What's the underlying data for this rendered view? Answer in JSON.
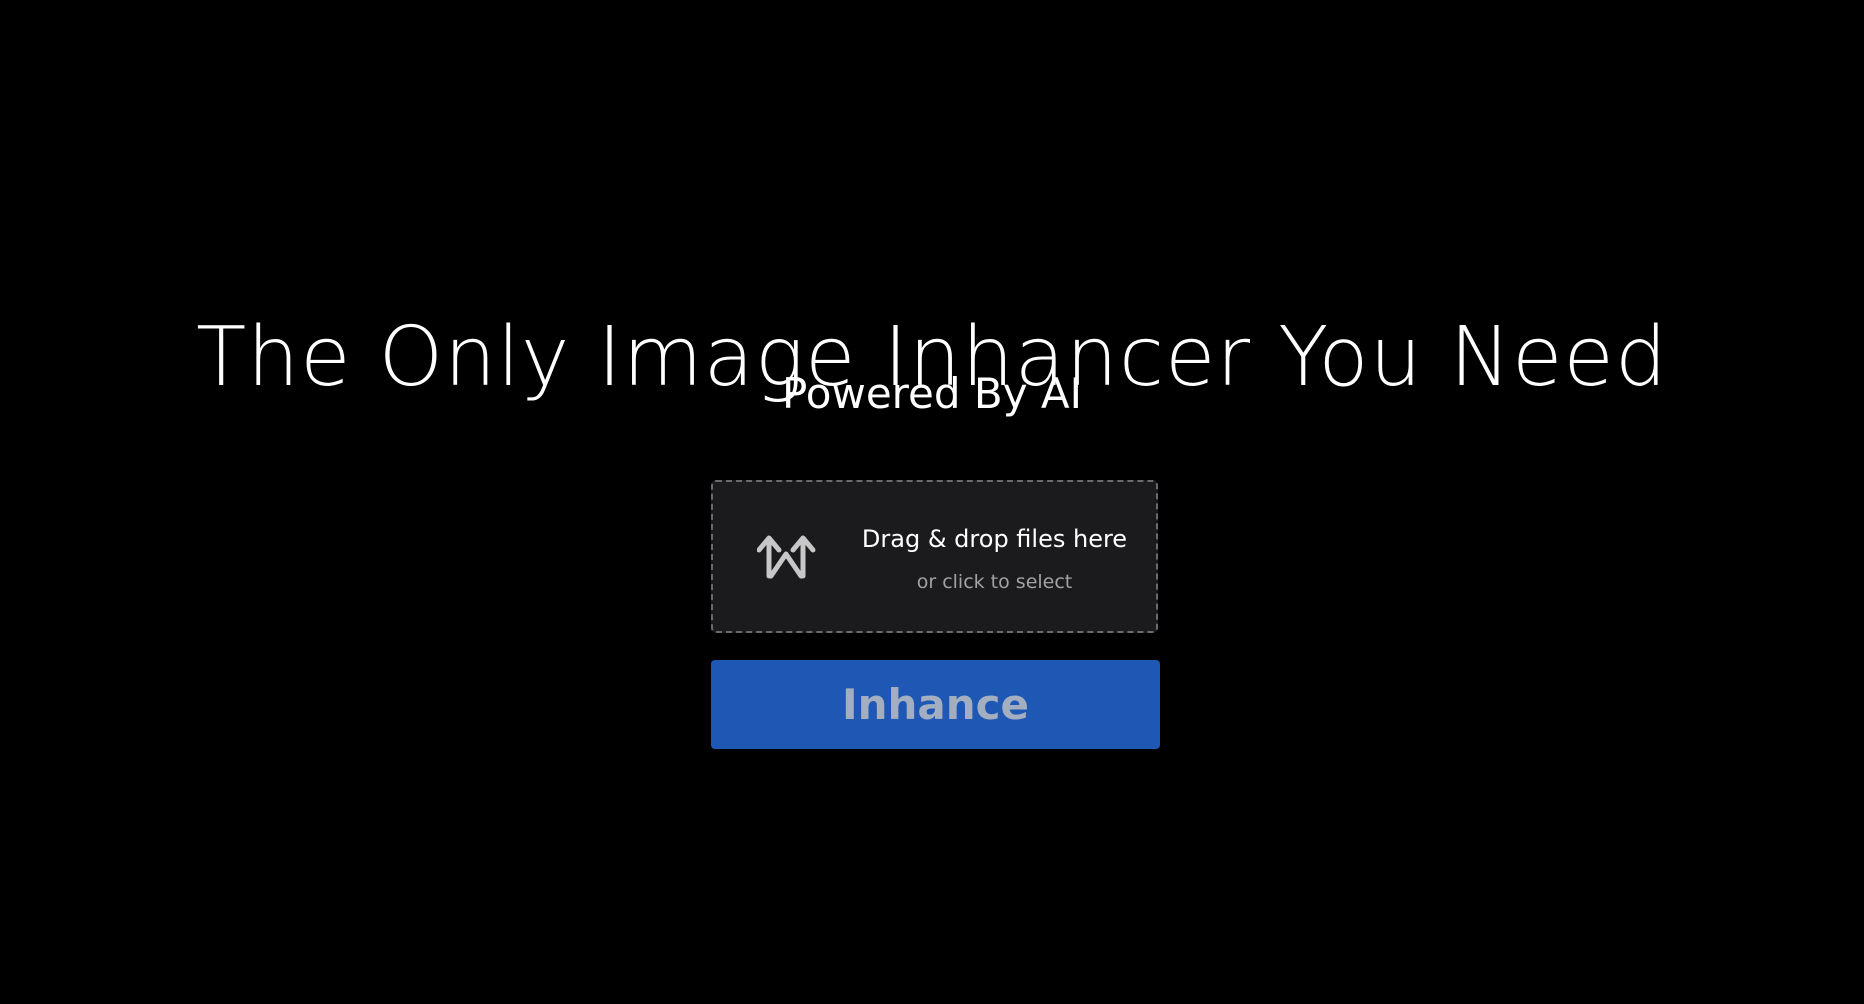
{
  "hero": {
    "title": "The Only Image Inhancer You Need",
    "subtitle": "Powered By AI"
  },
  "dropzone": {
    "icon": "upload-arrows-icon",
    "title": "Drag & drop files here",
    "subtitle": "or click to select"
  },
  "action": {
    "button_label": "Inhance",
    "button_color": "#1f58b4",
    "button_text_color": "#a4aec1"
  },
  "colors": {
    "background": "#000000",
    "dropzone_background": "#1b1b1d",
    "dropzone_border": "#6b6b6b"
  }
}
